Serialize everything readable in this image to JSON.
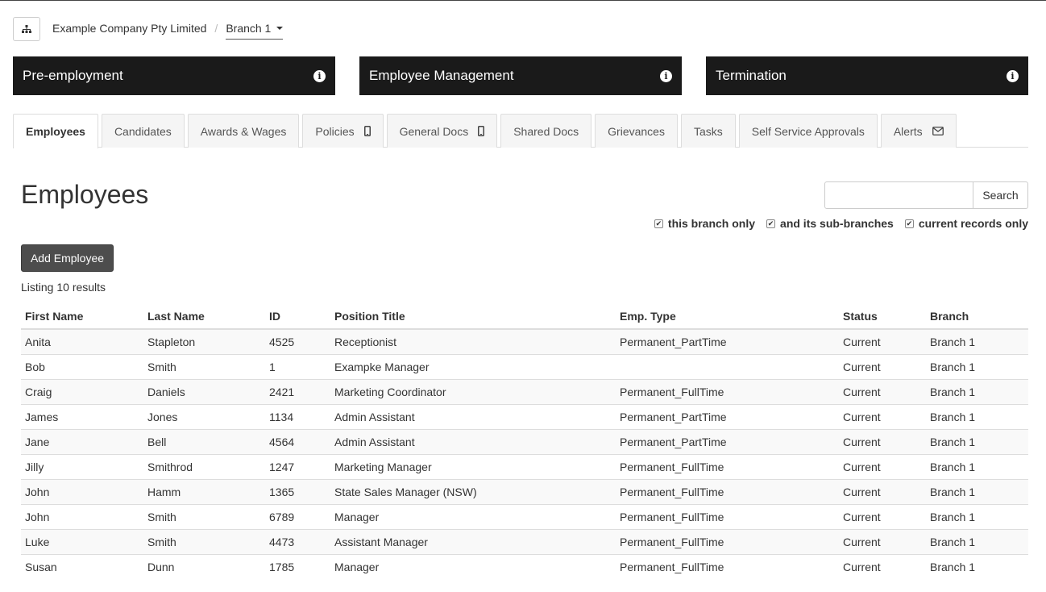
{
  "breadcrumb": {
    "company": "Example Company Pty Limited",
    "separator": "/",
    "branch": "Branch 1"
  },
  "panels": [
    {
      "label": "Pre-employment",
      "icon": "info-icon"
    },
    {
      "label": "Employee Management",
      "icon": "info-icon"
    },
    {
      "label": "Termination",
      "icon": "info-icon"
    }
  ],
  "tabs": [
    {
      "label": "Employees",
      "active": true
    },
    {
      "label": "Candidates"
    },
    {
      "label": "Awards & Wages"
    },
    {
      "label": "Policies",
      "icon": "mobile-icon"
    },
    {
      "label": "General Docs",
      "icon": "mobile-icon"
    },
    {
      "label": "Shared Docs"
    },
    {
      "label": "Grievances"
    },
    {
      "label": "Tasks"
    },
    {
      "label": "Self Service Approvals"
    },
    {
      "label": "Alerts",
      "icon": "envelope-icon"
    }
  ],
  "page": {
    "title": "Employees",
    "add_button": "Add Employee",
    "listing": "Listing 10 results"
  },
  "search": {
    "value": "",
    "button": "Search"
  },
  "filters": [
    {
      "label": "this branch only",
      "checked": true
    },
    {
      "label": "and its sub-branches",
      "checked": true
    },
    {
      "label": "current records only",
      "checked": true
    }
  ],
  "table": {
    "columns": [
      "First Name",
      "Last Name",
      "ID",
      "Position Title",
      "Emp. Type",
      "Status",
      "Branch"
    ],
    "rows": [
      [
        "Anita",
        "Stapleton",
        "4525",
        "Receptionist",
        "Permanent_PartTime",
        "Current",
        "Branch 1"
      ],
      [
        "Bob",
        "Smith",
        "1",
        "Exampke Manager",
        "",
        "Current",
        "Branch 1"
      ],
      [
        "Craig",
        "Daniels",
        "2421",
        "Marketing Coordinator",
        "Permanent_FullTime",
        "Current",
        "Branch 1"
      ],
      [
        "James",
        "Jones",
        "1134",
        "Admin Assistant",
        "Permanent_PartTime",
        "Current",
        "Branch 1"
      ],
      [
        "Jane",
        "Bell",
        "4564",
        "Admin Assistant",
        "Permanent_PartTime",
        "Current",
        "Branch 1"
      ],
      [
        "Jilly",
        "Smithrod",
        "1247",
        "Marketing Manager",
        "Permanent_FullTime",
        "Current",
        "Branch 1"
      ],
      [
        "John",
        "Hamm",
        "1365",
        "State Sales Manager (NSW)",
        "Permanent_FullTime",
        "Current",
        "Branch 1"
      ],
      [
        "John",
        "Smith",
        "6789",
        "Manager",
        "Permanent_FullTime",
        "Current",
        "Branch 1"
      ],
      [
        "Luke",
        "Smith",
        "4473",
        "Assistant Manager",
        "Permanent_FullTime",
        "Current",
        "Branch 1"
      ],
      [
        "Susan",
        "Dunn",
        "1785",
        "Manager",
        "Permanent_FullTime",
        "Current",
        "Branch 1"
      ]
    ]
  },
  "colors": {
    "panel_bg": "#1a1a1a",
    "button_bg": "#4d4d4d",
    "stripe": "#f9f9f9",
    "border": "#dddddd"
  }
}
